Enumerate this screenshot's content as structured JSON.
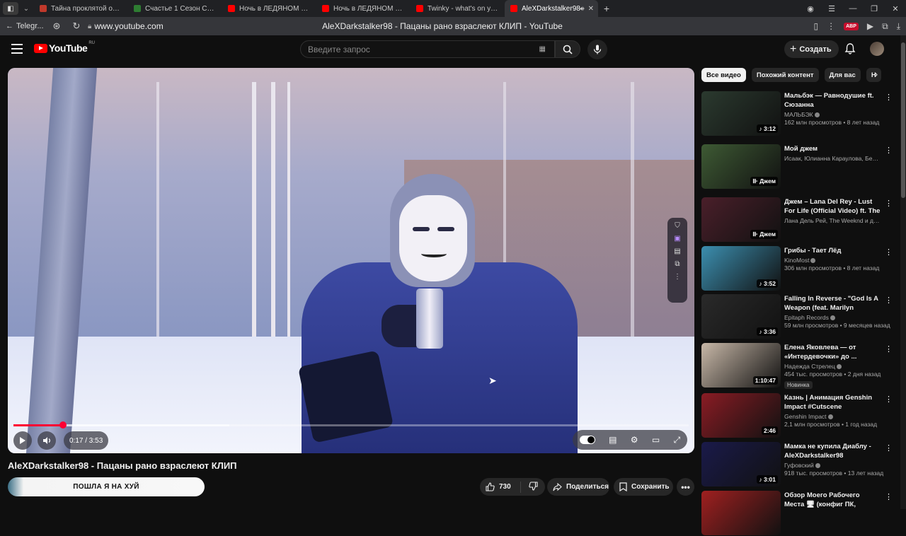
{
  "browser": {
    "tabs": [
      {
        "label": "Тайна проклятой обител",
        "color": "#c0392b"
      },
      {
        "label": "Счастье 1 Сезон Смотре",
        "color": "#2e7d32"
      },
      {
        "label": "Ночь в ЛЕДЯНОМ отеле",
        "color": "#ff0000"
      },
      {
        "label": "Ночь в ЛЕДЯНОМ отеле",
        "color": "#ff0000"
      },
      {
        "label": "Twinky - what's on your m",
        "color": "#ff0000"
      },
      {
        "label": "AleXDarkstalker98 -",
        "color": "#ff0000",
        "active": true
      }
    ],
    "back_label": "Telegr...",
    "url": "www.youtube.com",
    "page_title": "AleXDarkstalker98 - Пацаны рано взраслеют КЛИП - YouTube",
    "abp": "ABP"
  },
  "header": {
    "logo": "YouTube",
    "region": "RU",
    "search_placeholder": "Введите запрос",
    "create_label": "Создать"
  },
  "player": {
    "time": "0:17 / 3:53",
    "progress_fraction": 0.073
  },
  "video": {
    "title": "AleXDarkstalker98 - Пацаны рано взраслеют КЛИП",
    "channel_bar_text": "ПОШЛА Я НА ХУЙ",
    "likes": "730",
    "share_label": "Поделиться",
    "save_label": "Сохранить"
  },
  "sidebar": {
    "chips": [
      "Все видео",
      "Похожий контент",
      "Для вас",
      "Н"
    ],
    "items": [
      {
        "title": "Мальбэк — Равнодушие ft. Сюзанна",
        "channel": "МАЛЬБЭК",
        "verified": true,
        "views": "162 млн просмотров • 8 лет назад",
        "duration": "♪ 3:12",
        "bg": "#2b3a2f"
      },
      {
        "title": "Мой джем",
        "channel": "Исаак, Юлианна Караулова, Бенсон Бу...",
        "verified": false,
        "views": "",
        "duration": "⊪ Джем",
        "bg": "#3e5a34"
      },
      {
        "title": "Джем – Lana Del Rey - Lust For Life (Official Video) ft. The ...",
        "channel": "Лана Дель Рей, The Weeknd и другие и...",
        "verified": false,
        "views": "",
        "duration": "⊪ Джем",
        "bg": "#4a1f2a"
      },
      {
        "title": "Грибы - Тает Лёд",
        "channel": "KinoMost",
        "verified": true,
        "views": "306 млн просмотров • 8 лет назад",
        "duration": "♪ 3:52",
        "bg": "#3c8fb0"
      },
      {
        "title": "Falling In Reverse - \"God Is A Weapon (feat. Marilyn Manson)\"",
        "channel": "Epitaph Records",
        "verified": true,
        "views": "59 млн просмотров • 9 месяцев назад",
        "duration": "♪ 3:36",
        "bg": "#2a2a2a"
      },
      {
        "title": "Елена Яковлева — от «Интердевочки» до ...",
        "channel": "Надежда Стрелец",
        "verified": true,
        "views": "454 тыс. просмотров • 2 дня назад",
        "badge": "Новинка",
        "duration": "1:10:47",
        "bg": "#c8b8a8"
      },
      {
        "title": "Казнь | Анимация Genshin Impact #Cutscene #Animation...",
        "channel": "Genshin Impact",
        "verified": true,
        "views": "2,1 млн просмотров • 1 год назад",
        "duration": "2:46",
        "bg": "#8a1c24"
      },
      {
        "title": "Мамка не купила Диаблу - AleXDarkstalker98",
        "channel": "Гуфовский",
        "verified": true,
        "views": "918 тыс. просмотров • 13 лет назад",
        "duration": "♪ 3:01",
        "bg": "#1a1a4a"
      },
      {
        "title": "Обзор Моего Рабочего Места 🖥 (конфиг ПК, список ...",
        "channel": "",
        "verified": false,
        "views": "",
        "duration": "",
        "bg": "#a02020"
      }
    ]
  }
}
